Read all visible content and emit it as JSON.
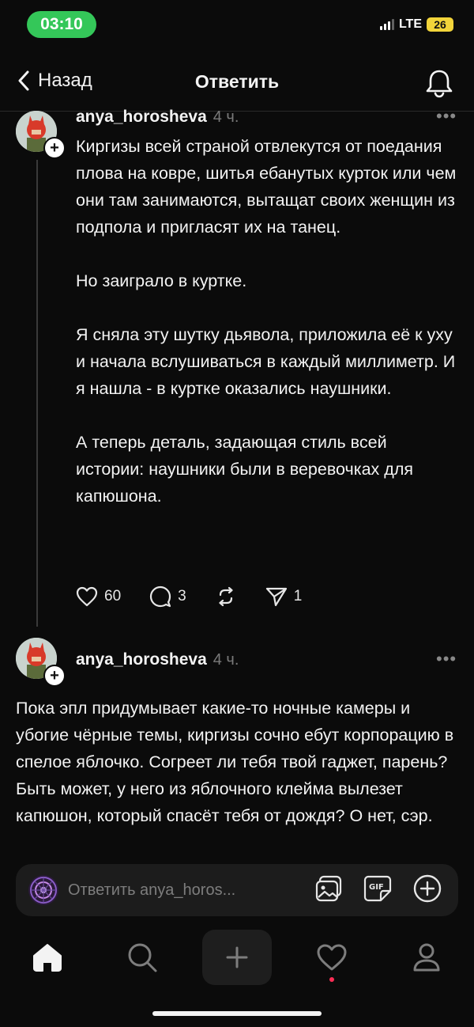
{
  "status_bar": {
    "time": "03:10",
    "network": "LTE",
    "battery": "26"
  },
  "nav": {
    "back_label": "Назад",
    "title": "Ответить"
  },
  "post1": {
    "username": "anya_horosheva",
    "time": "4 ч.",
    "paragraphs": [
      "Киргизы всей страной отвлекутся от поедания плова на ковре, шитья ебанутых курток или чем они там занимаются, вытащат своих женщин из подпола и пригласят их на танец.",
      "Но заиграло в куртке.",
      "Я сняла эту шутку дьявола, приложила её к уху и начала вслушиваться в каждый миллиметр. И я нашла - в куртке оказались наушники.",
      "А теперь деталь, задающая стиль всей истории: наушники были в веревочках для капюшона."
    ],
    "likes": "60",
    "replies": "3",
    "shares": "1"
  },
  "post2": {
    "username": "anya_horosheva",
    "time": "4 ч.",
    "text": "Пока эпл придумывает какие-то ночные камеры и убогие чёрные темы, киргизы сочно ебут корпорацию в спелое яблочко. Согреет ли тебя твой гаджет, парень? Быть может, у него из яблочного клейма вылезет капюшон, который спасёт тебя от дождя? О нет, сэр."
  },
  "reply_bar": {
    "placeholder": "Ответить anya_horos..."
  },
  "tabs": [
    "home-icon",
    "search-icon",
    "create-icon",
    "heart-icon",
    "profile-icon"
  ],
  "colors": {
    "background": "#0b0b0b",
    "time_pill": "#34c759",
    "battery": "#f2d43a",
    "notification_dot": "#ff2d55"
  }
}
